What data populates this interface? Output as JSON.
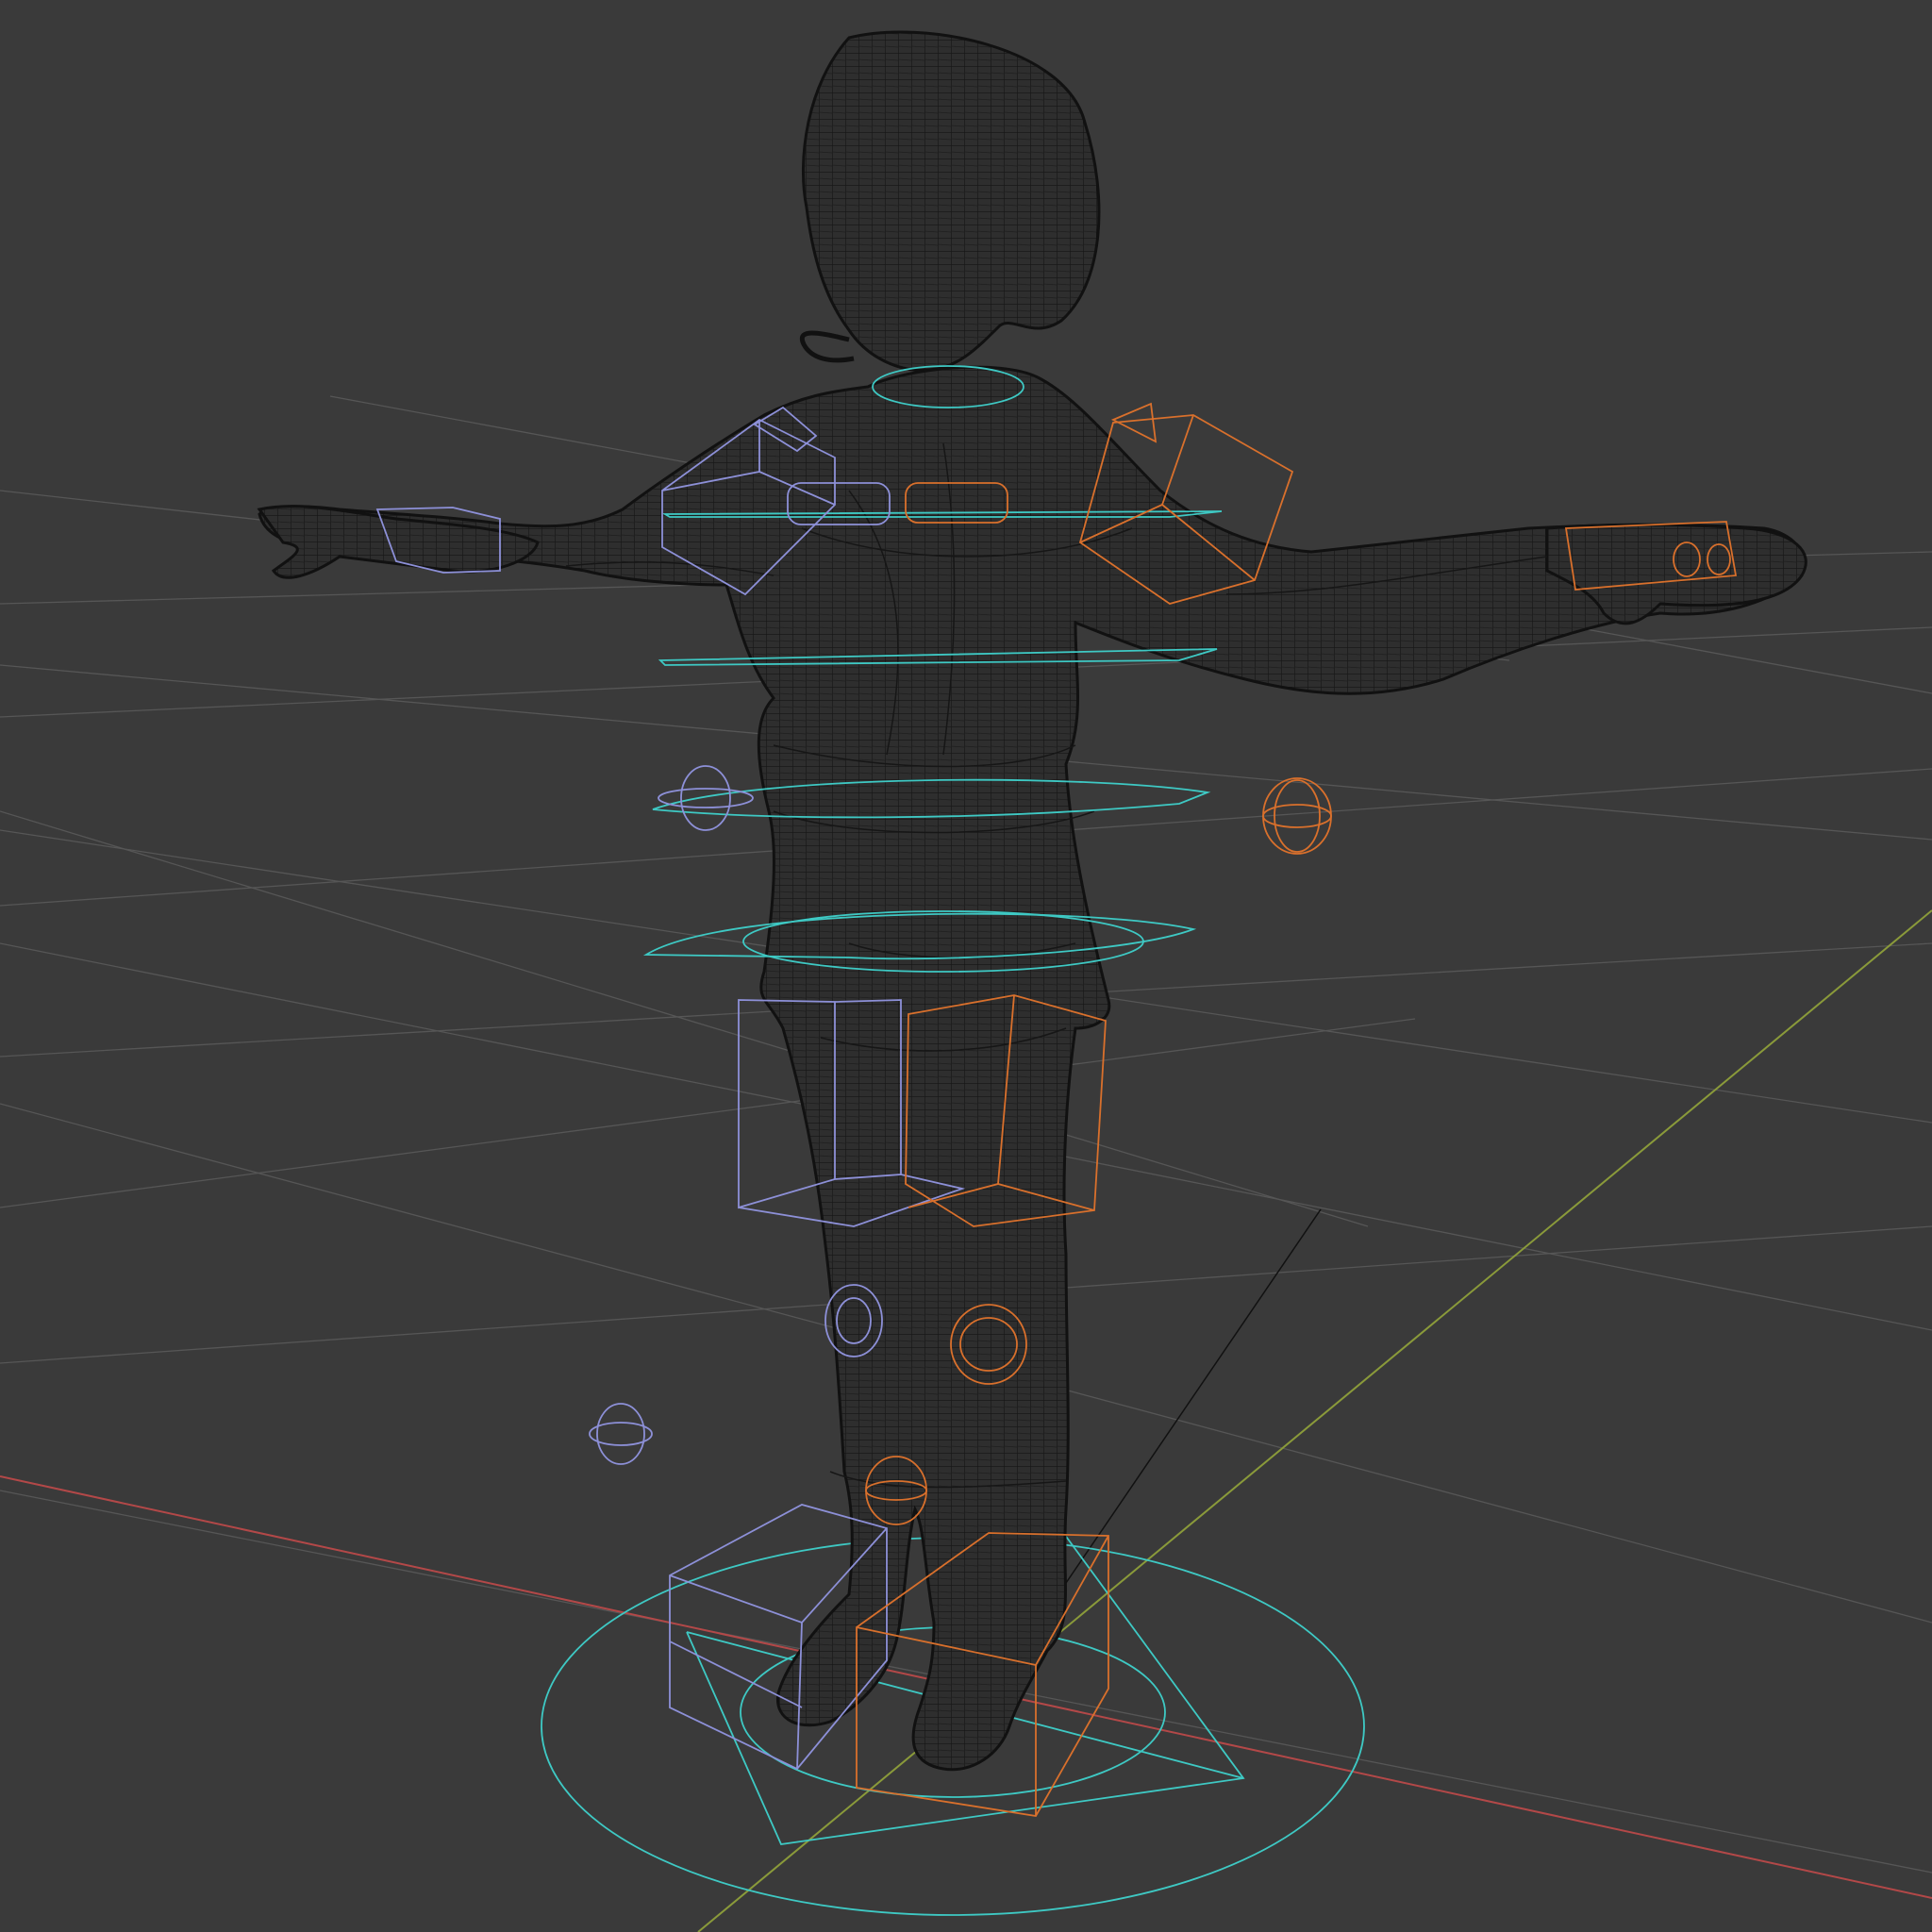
{
  "viewport": {
    "mode": "wireframe",
    "background": "#3a3a3a"
  },
  "colors": {
    "grid": "#555555",
    "x_axis": "#b34848",
    "y_axis": "#8a9a3a",
    "mesh": "#1a1a1a",
    "mesh_fill": "#2b2b2b",
    "control_left": "#8d90d8",
    "control_right": "#d9702c",
    "control_center": "#3ec9c4",
    "light_line": "#111111"
  },
  "icons": {
    "character": "character-mesh-icon",
    "control": "rig-control-icon"
  }
}
